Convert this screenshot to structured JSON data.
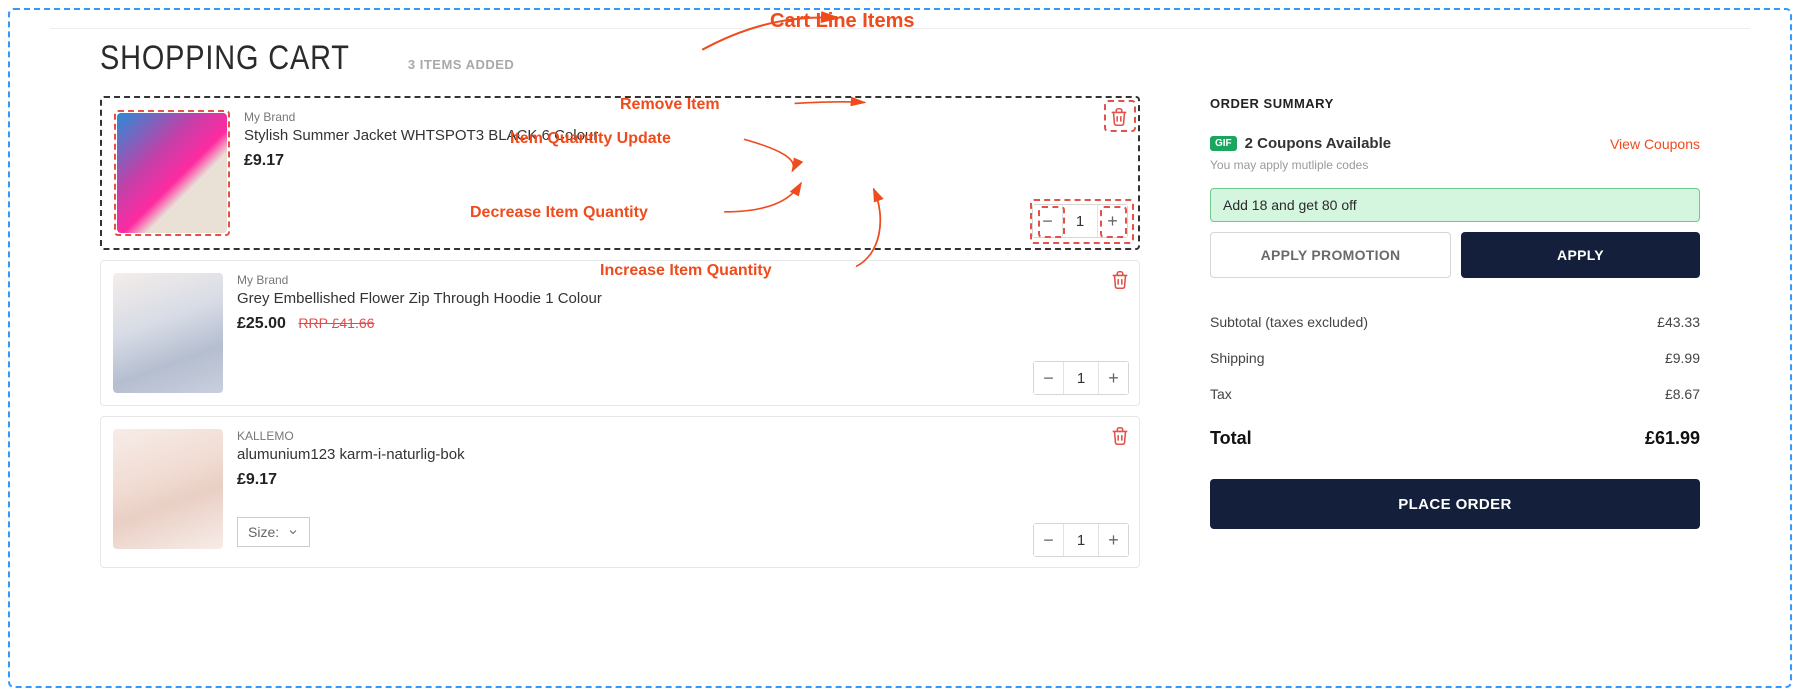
{
  "header": {
    "title": "SHOPPING CART",
    "items_added": "3 ITEMS ADDED"
  },
  "cart_items": [
    {
      "brand": "My Brand",
      "name": "Stylish Summer Jacket WHTSPOT3 BLACK 6 Colour",
      "price": "£9.17",
      "qty": "1"
    },
    {
      "brand": "My Brand",
      "name": "Grey Embellished Flower Zip Through Hoodie 1 Colour",
      "price": "£25.00",
      "rrp": "RRP £41.66",
      "qty": "1"
    },
    {
      "brand": "KALLEMO",
      "name": "alumunium123 karm-i-naturlig-bok",
      "price": "£9.17",
      "size_label": "Size:",
      "qty": "1"
    }
  ],
  "annotations": {
    "cart_line_items": "Cart Line Items",
    "remove_item": "Remove Item",
    "item_qty_update": "Item Quantity Update",
    "decrease": "Decrease Item Quantity",
    "increase": "Increase Item Quantity"
  },
  "summary": {
    "title": "ORDER SUMMARY",
    "gif_badge": "GIF",
    "coupons_available": "2 Coupons Available",
    "view_coupons": "View Coupons",
    "coupons_sub": "You may apply mutliple codes",
    "promo_banner": "Add 18 and get 80 off",
    "apply_promo": "APPLY PROMOTION",
    "apply": "APPLY",
    "rows": {
      "subtotal_label": "Subtotal (taxes excluded)",
      "subtotal_value": "£43.33",
      "shipping_label": "Shipping",
      "shipping_value": "£9.99",
      "tax_label": "Tax",
      "tax_value": "£8.67",
      "total_label": "Total",
      "total_value": "£61.99"
    },
    "place_order": "PLACE ORDER"
  }
}
